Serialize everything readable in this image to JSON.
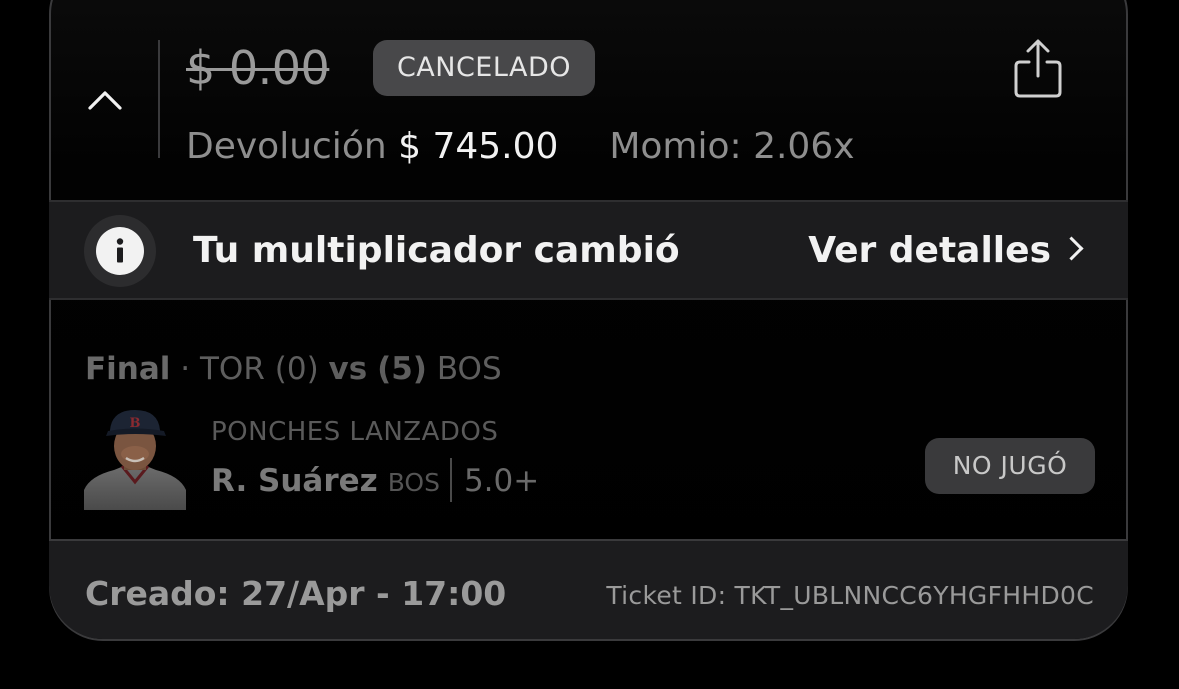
{
  "bet": {
    "stake": "$ 0.00",
    "status_badge": "CANCELADO",
    "refund_label": "Devolución",
    "refund_value": "$ 745.00",
    "odds_label": "Momio: 2.06x"
  },
  "icons": {
    "collapse": "chevron-up-icon",
    "share": "share-icon",
    "info": "info-icon",
    "details": "chevron-right-icon"
  },
  "banner": {
    "text": "Tu multiplicador cambió",
    "link": "Ver detalles"
  },
  "game": {
    "status": "Final",
    "separator": "·",
    "team_away": "TOR",
    "score_away": "(0)",
    "vs": "vs",
    "score_home": "(5)",
    "team_home": "BOS"
  },
  "selection": {
    "market": "PONCHES LANZADOS",
    "player": "R. Suárez",
    "team": "BOS",
    "line": "5.0+",
    "result_badge": "NO JUGÓ"
  },
  "footer": {
    "created": "Creado: 27/Apr - 17:00",
    "ticket_id": "Ticket ID: TKT_UBLNNCC6YHGFHHD0C"
  },
  "colors": {
    "background": "#000000",
    "banner_bg": "#1c1c1e",
    "badge_bg": "#48484a",
    "team_red": "#bd3039"
  }
}
